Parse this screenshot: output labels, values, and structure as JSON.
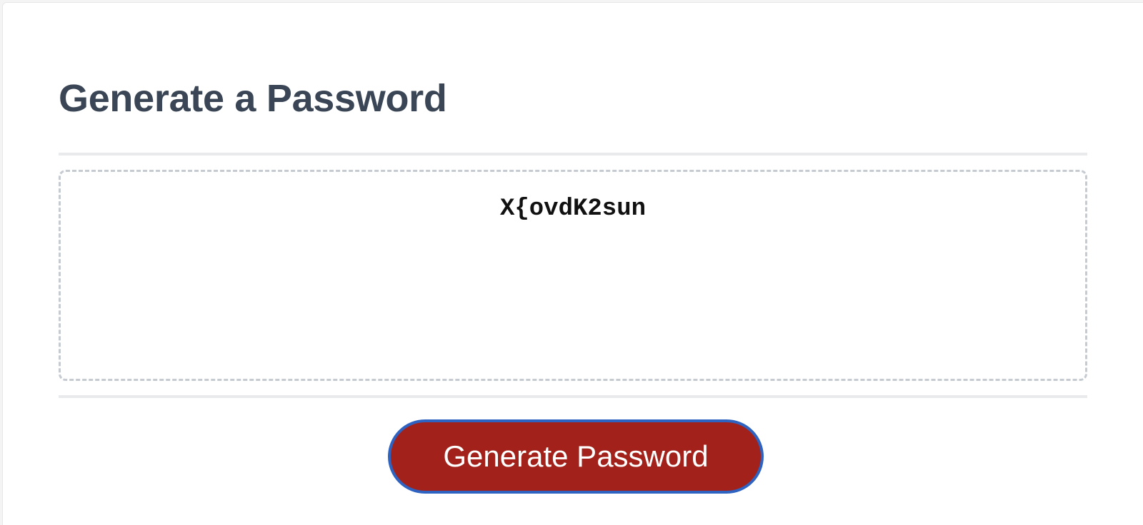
{
  "header": {
    "title": "Generate a Password"
  },
  "password": {
    "value": "X{ovdK2sun",
    "placeholder": ""
  },
  "actions": {
    "generate_label": "Generate Password"
  },
  "colors": {
    "button_background": "#a2221b",
    "button_border": "#2f63c2",
    "title_text": "#3a4655",
    "dashed_border": "#c6cbd2"
  }
}
